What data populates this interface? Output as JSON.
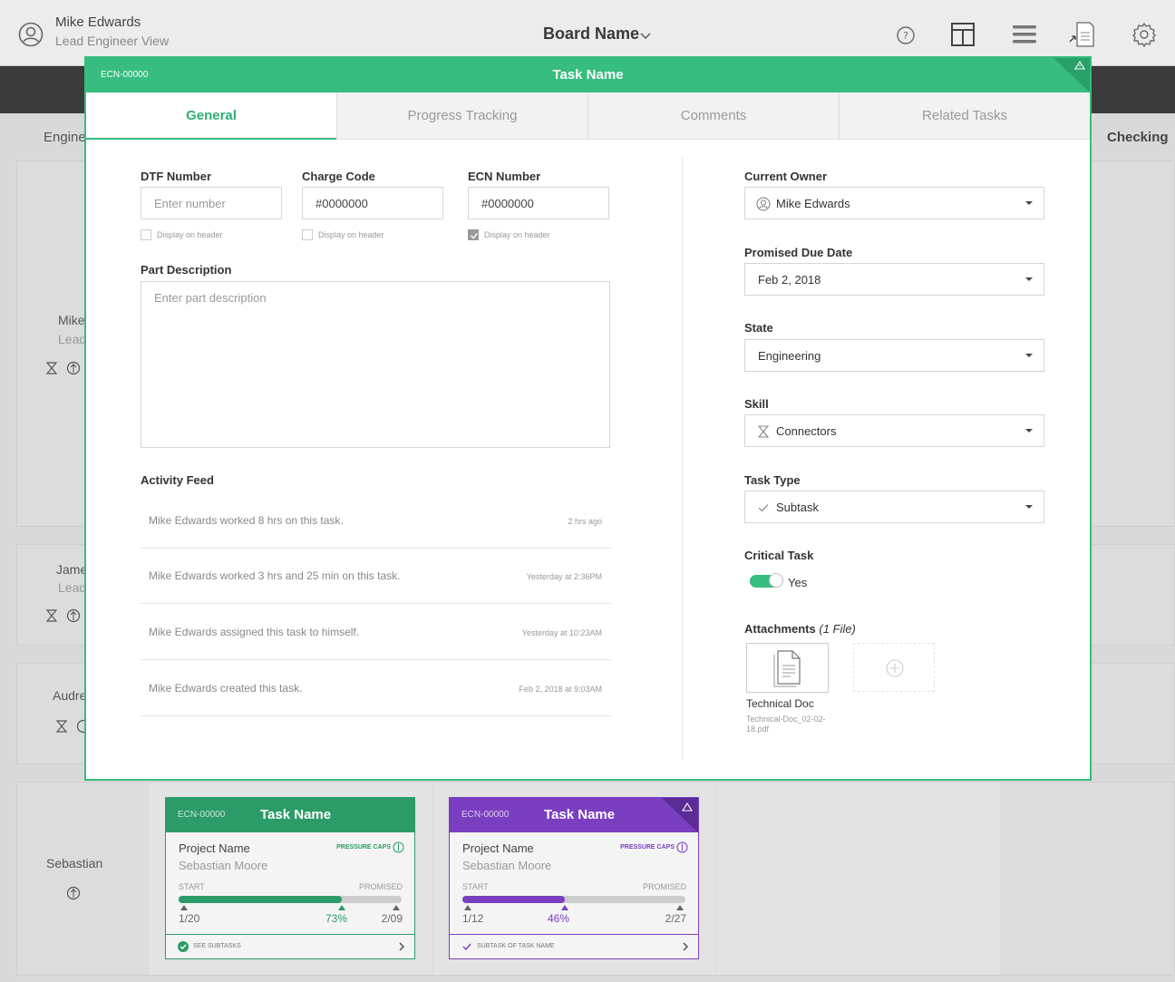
{
  "header": {
    "user_name": "Mike Edwards",
    "user_role": "Lead Engineer View",
    "board_name": "Board Name"
  },
  "background": {
    "columns": [
      "Engine",
      "Checking"
    ],
    "lanes": [
      {
        "name": "Mike",
        "sub": "Lead"
      },
      {
        "name": "Jame",
        "sub": "Lead"
      },
      {
        "name": "Audre",
        "sub": ""
      },
      {
        "name": "Sebastian",
        "sub": ""
      }
    ],
    "cards": [
      {
        "id": "ECN-00000",
        "title": "Task Name",
        "project": "Project Name",
        "person": "Sebastian Moore",
        "badge": "PRESSURE CAPS",
        "start_label": "START",
        "promised_label": "PROMISED",
        "start_date": "1/20",
        "progress": "73%",
        "progress_value": 0.73,
        "promised_date": "2/09",
        "footer": "SEE SUBTASKS",
        "color": "#2b9c67"
      },
      {
        "id": "ECN-00000",
        "title": "Task Name",
        "project": "Project Name",
        "person": "Sebastian Moore",
        "badge": "PRESSURE CAPS",
        "start_label": "START",
        "promised_label": "PROMISED",
        "start_date": "1/12",
        "progress": "46%",
        "progress_value": 0.46,
        "promised_date": "2/27",
        "footer": "SUBTASK OF TASK NAME",
        "color": "#7a3fc1"
      }
    ]
  },
  "modal": {
    "id": "ECN-00000",
    "title": "Task Name",
    "accent": "#36bd7f",
    "tabs": [
      "General",
      "Progress Tracking",
      "Comments",
      "Related Tasks"
    ],
    "active_tab": 0,
    "fields": {
      "dtf": {
        "label": "DTF Number",
        "placeholder": "Enter number",
        "value": "",
        "display_on_header": "Display on header",
        "checked": false
      },
      "charge": {
        "label": "Charge Code",
        "placeholder": "",
        "value": "#0000000",
        "display_on_header": "Display on header",
        "checked": false
      },
      "ecn": {
        "label": "ECN Number",
        "placeholder": "",
        "value": "#0000000",
        "display_on_header": "Display on header",
        "checked": true
      }
    },
    "part_description": {
      "label": "Part Description",
      "placeholder": "Enter part description"
    },
    "activity_feed": {
      "label": "Activity Feed",
      "items": [
        {
          "text": "Mike Edwards worked 8 hrs on this task.",
          "time": "2 hrs ago"
        },
        {
          "text": "Mike Edwards worked 3 hrs and 25 min on this task.",
          "time": "Yesterday at 2:36PM"
        },
        {
          "text": "Mike Edwards assigned this task to himself.",
          "time": "Yesterday at 10:23AM"
        },
        {
          "text": "Mike Edwards created this task.",
          "time": "Feb 2, 2018 at 9:03AM"
        }
      ]
    },
    "right": {
      "owner": {
        "label": "Current Owner",
        "value": "Mike Edwards",
        "icon": "user-icon"
      },
      "due": {
        "label": "Promised Due Date",
        "value": "Feb 2, 2018"
      },
      "state": {
        "label": "State",
        "value": "Engineering"
      },
      "skill": {
        "label": "Skill",
        "value": "Connectors",
        "icon": "hourglass-icon"
      },
      "task_type": {
        "label": "Task Type",
        "value": "Subtask",
        "icon": "check-icon"
      },
      "critical": {
        "label": "Critical Task",
        "value": "Yes",
        "on": true
      },
      "attachments": {
        "label": "Attachments",
        "count": "(1 File)",
        "file_title": "Technical Doc",
        "file_name": "Technical-Doc_02-02-18.pdf"
      }
    }
  }
}
